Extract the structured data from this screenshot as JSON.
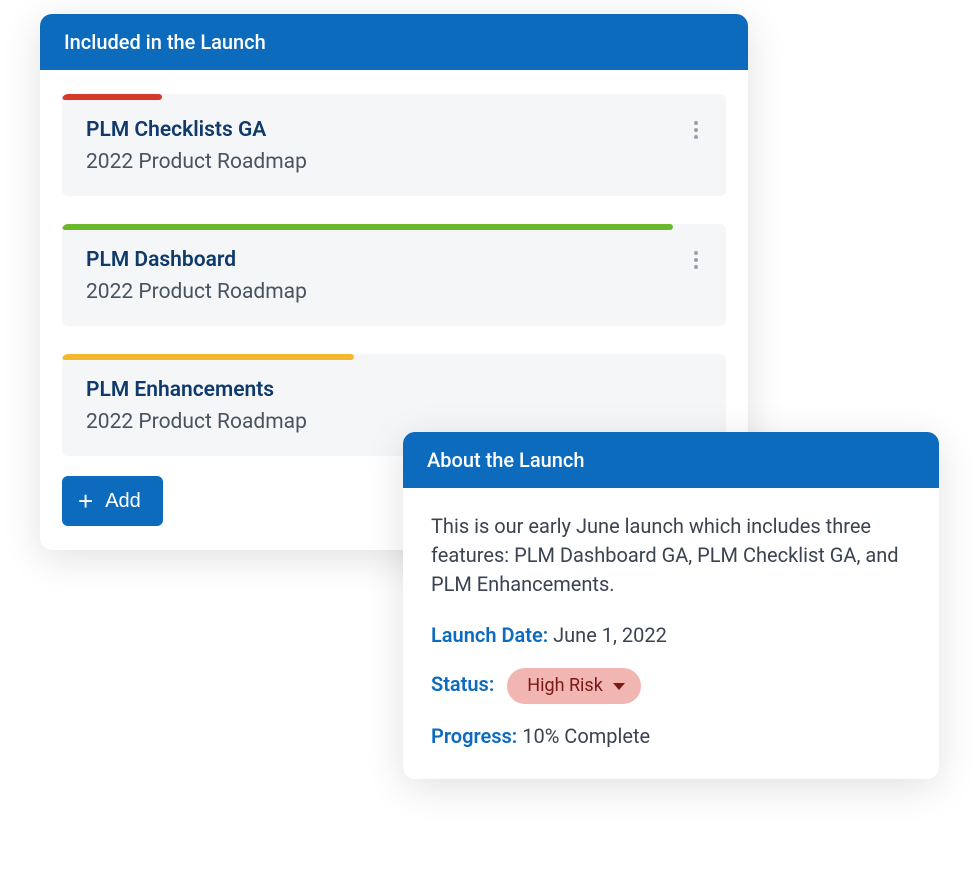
{
  "launchPanel": {
    "title": "Included in the Launch",
    "addLabel": "Add",
    "cards": [
      {
        "title": "PLM Checklists GA",
        "subtitle": "2022 Product Roadmap",
        "progressColor": "#d53a2b",
        "progressWidth": "15%",
        "hasMenu": true
      },
      {
        "title": "PLM Dashboard",
        "subtitle": "2022 Product Roadmap",
        "progressColor": "#6cb82c",
        "progressWidth": "92%",
        "hasMenu": true
      },
      {
        "title": "PLM Enhancements",
        "subtitle": "2022 Product Roadmap",
        "progressColor": "#f2b92f",
        "progressWidth": "44%",
        "hasMenu": false
      }
    ]
  },
  "aboutPanel": {
    "title": "About the Launch",
    "description": "This is our early June launch which includes three features: PLM Dashboard GA, PLM Checklist GA, and PLM Enhancements.",
    "launchDateLabel": "Launch Date:",
    "launchDateValue": "June 1, 2022",
    "statusLabel": "Status:",
    "statusValue": "High Risk",
    "progressLabel": "Progress:",
    "progressValue": "10% Complete"
  }
}
